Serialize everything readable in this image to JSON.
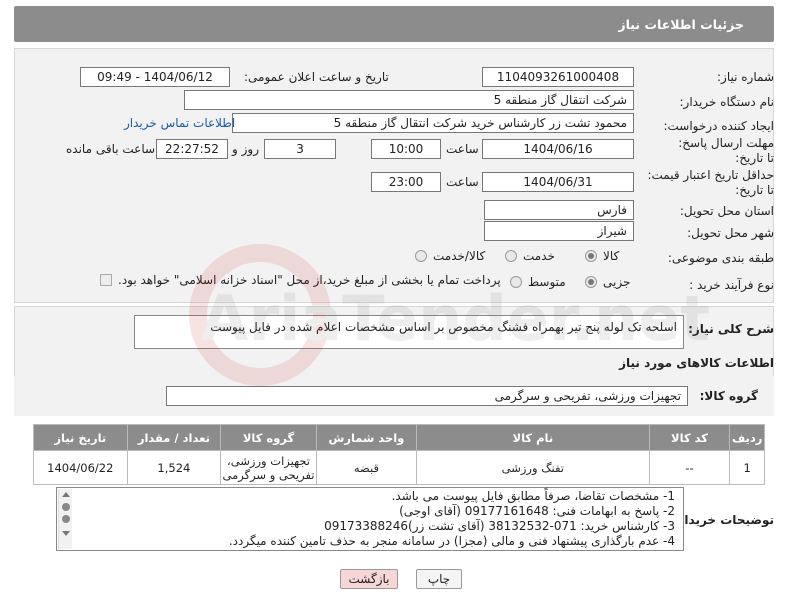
{
  "header": {
    "title": "جزئیات اطلاعات نیاز"
  },
  "fields": {
    "need_number": {
      "label": "شماره نیاز:",
      "value": "1104093261000408"
    },
    "announce_datetime": {
      "label": "تاریخ و ساعت اعلان عمومی:",
      "value": "1404/06/12 - 09:49"
    },
    "buyer_org": {
      "label": "نام دستگاه خریدار:",
      "value": "شرکت انتقال گاز منطقه 5"
    },
    "creator": {
      "label": "ایجاد کننده درخواست:",
      "value": "محمود تشت زر کارشناس خرید شرکت انتقال گاز منطقه 5",
      "link": "اطلاعات تماس خریدار"
    },
    "deadline": {
      "label": "مهلت ارسال پاسخ: تا تاریخ:",
      "date": "1404/06/16",
      "time_label": "ساعت",
      "time": "10:00",
      "days": "3",
      "days_label": "روز و",
      "remaining": "22:27:52",
      "remaining_label": "ساعت باقی مانده"
    },
    "price_validity": {
      "label": "حداقل تاریخ اعتبار قیمت: تا تاریخ:",
      "date": "1404/06/31",
      "time_label": "ساعت",
      "time": "23:00"
    },
    "province": {
      "label": "استان محل تحویل:",
      "value": "فارس"
    },
    "city": {
      "label": "شهر محل تحویل:",
      "value": "شیراز"
    },
    "category": {
      "label": "طبقه بندی موضوعی:",
      "options": [
        "کالا",
        "خدمت",
        "کالا/خدمت"
      ],
      "selected": 0
    },
    "process_type": {
      "label": "نوع فرآیند خرید :",
      "options": [
        "جزیی",
        "متوسط"
      ],
      "selected": 0,
      "payment_note": "پرداخت تمام یا بخشی از مبلغ خرید،از محل \"اسناد خزانه اسلامی\" خواهد بود."
    }
  },
  "description": {
    "label": "شرح کلی نیاز:",
    "value": "اسلحه تک لوله پنج تیر بهمراه فشنگ مخصوص بر اساس مشخصات اعلام شده در فایل پیوست"
  },
  "goods_section": {
    "title": "اطلاعات کالاهای مورد نیاز"
  },
  "goods_group": {
    "label": "گروه کالا:",
    "value": "تجهیزات ورزشی، تفریحی و سرگرمی"
  },
  "table": {
    "headers": [
      "ردیف",
      "کد کالا",
      "نام کالا",
      "واحد شمارش",
      "گروه کالا",
      "تعداد / مقدار",
      "تاریخ نیاز"
    ],
    "rows": [
      {
        "row": "1",
        "code": "--",
        "name": "تفنگ ورزشی",
        "unit": "قبضه",
        "group": "تجهیزات ورزشی، تفریحی و سرگرمی",
        "qty": "1,524",
        "date": "1404/06/22"
      }
    ]
  },
  "buyer_notes": {
    "label": "توضیحات خریدار:",
    "lines": [
      "1-  مشخصات تقاضا، صرفاً مطابق فایل پیوست می باشد.",
      "2- پاسخ به ابهامات فنی: 09177161648 (آقای اوجی)",
      "3- کارشناس خرید: 071-38132532 (آقای تشت زر)09173388246",
      "4- عدم بارگذاری پیشنهاد فنی و مالی (مجزا) در سامانه منجر به حذف تامین کننده میگردد."
    ]
  },
  "buttons": {
    "print": "چاپ",
    "back": "بازگشت"
  },
  "watermark": {
    "text": "AriaTender.net"
  }
}
